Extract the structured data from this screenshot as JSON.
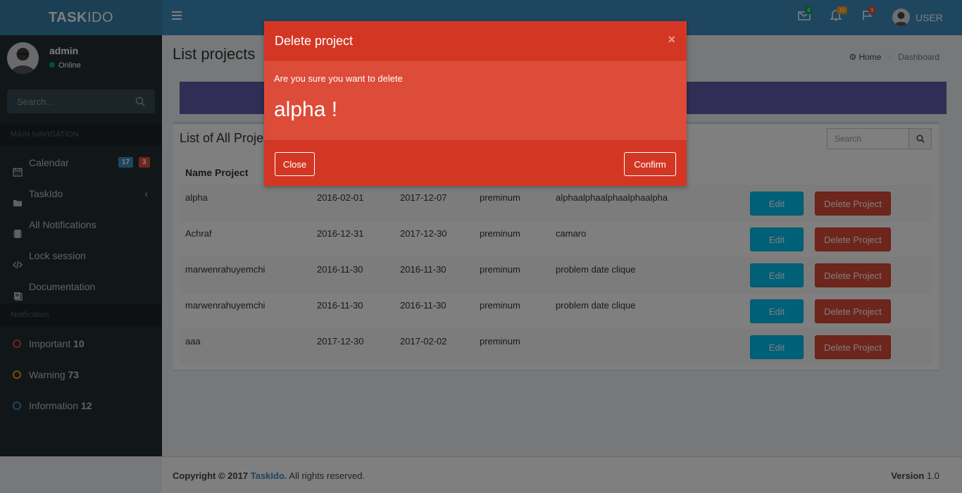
{
  "brand": {
    "logo_bold": "TASK",
    "logo_rest": "IDO"
  },
  "header": {
    "mail_count": "4",
    "bell_count": "10",
    "flag_count": "9",
    "user_label": "USER"
  },
  "sidebar": {
    "user_name": "admin",
    "user_status": "Online",
    "search_placeholder": "Search...",
    "main_nav_header": "MAIN NAVIGATION",
    "items": [
      {
        "label": "Calendar",
        "icon": "calendar-icon",
        "badge_blue": "17",
        "badge_red": "3"
      },
      {
        "label": "TaskIdo",
        "icon": "folder-icon"
      },
      {
        "label": "All Notifications",
        "icon": "notification-icon"
      },
      {
        "label": "Lock session",
        "icon": "code-icon"
      },
      {
        "label": "Documentation",
        "icon": "book-icon"
      }
    ],
    "notif_header": "Notification",
    "notifs": [
      {
        "label": "Important",
        "count": "10",
        "color": "#dd4b39"
      },
      {
        "label": "Warning",
        "count": "73",
        "color": "#f39c12"
      },
      {
        "label": "Information",
        "count": "12",
        "color": "#3c8dbc"
      }
    ]
  },
  "content": {
    "page_title": "List projects",
    "breadcrumb_home": "Home",
    "breadcrumb_current": "Dashboard",
    "box_title": "List of All Projects",
    "search_placeholder": "Search",
    "columns": [
      "Name Project"
    ],
    "rows": [
      {
        "name": "alpha",
        "start": "2016-02-01",
        "end": "2017-12-07",
        "type": "preminum",
        "desc": "alphaalphaalphaalphaalpha"
      },
      {
        "name": "Achraf",
        "start": "2016-12-31",
        "end": "2017-12-30",
        "type": "preminum",
        "desc": "camaro"
      },
      {
        "name": "marwenrahuyemchi",
        "start": "2016-11-30",
        "end": "2016-11-30",
        "type": "preminum",
        "desc": "problem date clique"
      },
      {
        "name": "marwenrahuyemchi",
        "start": "2016-11-30",
        "end": "2016-11-30",
        "type": "preminum",
        "desc": "problem date clique"
      },
      {
        "name": "aaa",
        "start": "2017-12-30",
        "end": "2017-02-02",
        "type": "preminum",
        "desc": ""
      }
    ],
    "edit_label": "Edit",
    "delete_label": "Delete Project"
  },
  "footer": {
    "copyright": "Copyright © 2017",
    "brand": "TaskIdo.",
    "rights": "All rights reserved.",
    "version_label": "Version",
    "version": "1.0"
  },
  "modal": {
    "title": "Delete project",
    "close_x": "×",
    "message": "Are you sure you want to delete",
    "project_name": "alpha !",
    "close_label": "Close",
    "confirm_label": "Confirm"
  }
}
